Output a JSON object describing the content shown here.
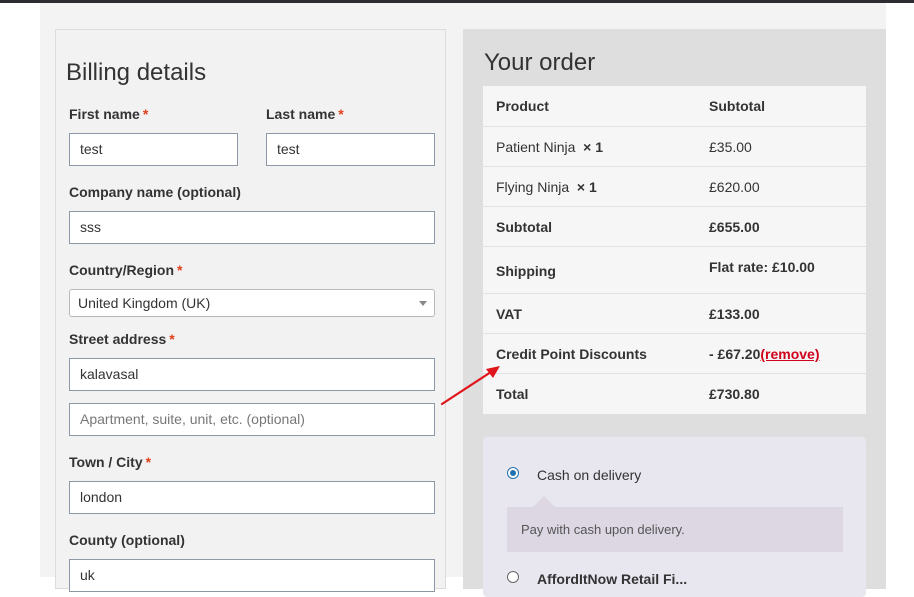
{
  "billing": {
    "title": "Billing details",
    "first_name_label": "First name",
    "last_name_label": "Last name",
    "first_name_value": "test",
    "last_name_value": "test",
    "company_label": "Company name (optional)",
    "company_value": "sss",
    "country_label": "Country/Region",
    "country_value": "United Kingdom (UK)",
    "street_label": "Street address",
    "street_value": "kalavasal",
    "apartment_placeholder": "Apartment, suite, unit, etc. (optional)",
    "town_label": "Town / City",
    "town_value": "london",
    "county_label": "County (optional)",
    "county_value": "uk",
    "required_mark": "*"
  },
  "order": {
    "title": "Your order",
    "head_product": "Product",
    "head_subtotal": "Subtotal",
    "items": [
      {
        "name": "Patient Ninja",
        "qty": "× 1",
        "price": "£35.00"
      },
      {
        "name": "Flying Ninja",
        "qty": "× 1",
        "price": "£620.00"
      }
    ],
    "subtotal_label": "Subtotal",
    "subtotal_value": "£655.00",
    "shipping_label": "Shipping",
    "shipping_value": "Flat rate: £10.00",
    "vat_label": "VAT",
    "vat_value": "£133.00",
    "discount_label": "Credit Point Discounts",
    "discount_value": "- £67.20",
    "discount_remove": "(remove)",
    "total_label": "Total",
    "total_value": "£730.80"
  },
  "payment": {
    "cod_label": "Cash on delivery",
    "cod_description": "Pay with cash upon delivery.",
    "second_label_partial": "AffordItNow Retail Fi..."
  },
  "colors": {
    "required": "#e2401c",
    "remove_link": "#d0021b",
    "arrow": "#e0141b",
    "radio": "#2271b1"
  }
}
